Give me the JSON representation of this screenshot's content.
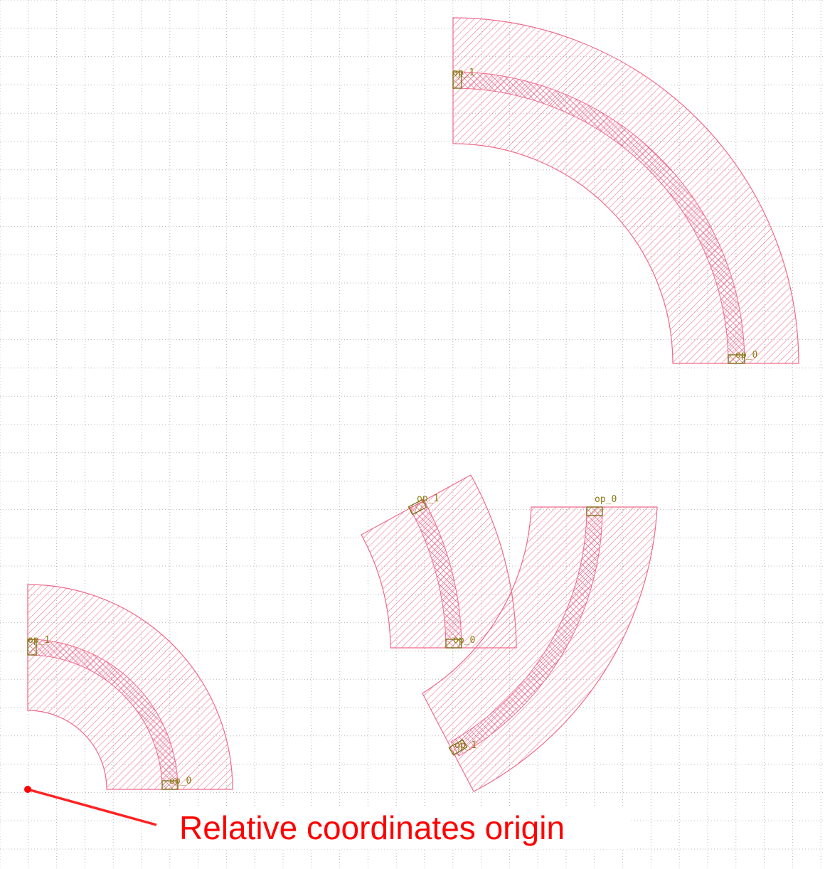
{
  "ports": {
    "a": {
      "in": "op_1",
      "out": "op_0"
    },
    "b": {
      "in": "op_1",
      "out": "op_0"
    },
    "c": {
      "in": "op_1",
      "out": "op_0"
    },
    "d": {
      "in": "op_0",
      "out": "op_1"
    }
  },
  "annotation": {
    "text": "Relative coordinates origin"
  },
  "colors": {
    "cladding": "#f06a8a",
    "port": "#7a6a10",
    "annotation": "#ff0000",
    "grid": "#b8b8b8"
  }
}
